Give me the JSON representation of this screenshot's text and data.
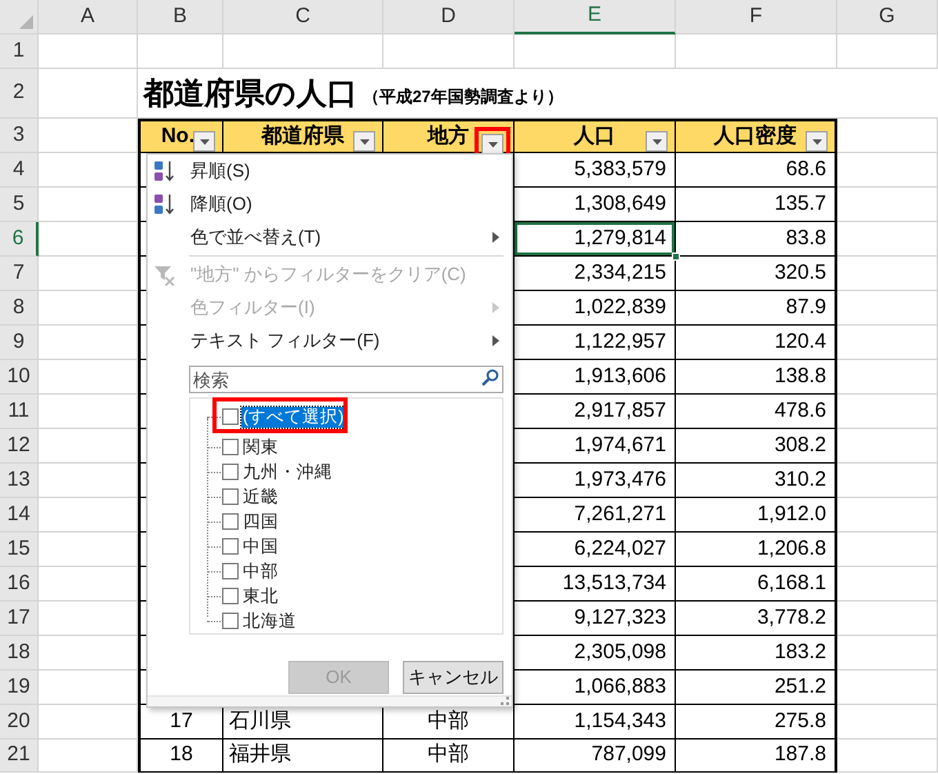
{
  "sheet": {
    "column_headers": [
      "A",
      "B",
      "C",
      "D",
      "E",
      "F",
      "G"
    ],
    "row_headers": [
      "1",
      "2",
      "3",
      "4",
      "5",
      "6",
      "7",
      "8",
      "9",
      "10",
      "11",
      "12",
      "13",
      "14",
      "15",
      "16",
      "17",
      "18",
      "19",
      "20",
      "21"
    ]
  },
  "title": "都道府県の人口",
  "subtitle": "（平成27年国勢調査より）",
  "table": {
    "columns": [
      {
        "label": "No.",
        "highlighted": false
      },
      {
        "label": "都道府県",
        "highlighted": false
      },
      {
        "label": "地方",
        "highlighted": true
      },
      {
        "label": "人口",
        "highlighted": false
      },
      {
        "label": "人口密度",
        "highlighted": false
      }
    ],
    "rows": [
      {
        "population": "5,383,579",
        "density": "68.6",
        "selected": false
      },
      {
        "population": "1,308,649",
        "density": "135.7",
        "selected": false
      },
      {
        "population": "1,279,814",
        "density": "83.8",
        "selected": true
      },
      {
        "population": "2,334,215",
        "density": "320.5",
        "selected": false
      },
      {
        "population": "1,022,839",
        "density": "87.9",
        "selected": false
      },
      {
        "population": "1,122,957",
        "density": "120.4",
        "selected": false
      },
      {
        "population": "1,913,606",
        "density": "138.8",
        "selected": false
      },
      {
        "population": "2,917,857",
        "density": "478.6",
        "selected": false
      },
      {
        "population": "1,974,671",
        "density": "308.2",
        "selected": false
      },
      {
        "population": "1,973,476",
        "density": "310.2",
        "selected": false
      },
      {
        "population": "7,261,271",
        "density": "1,912.0",
        "selected": false
      },
      {
        "population": "6,224,027",
        "density": "1,206.8",
        "selected": false
      },
      {
        "population": "13,513,734",
        "density": "6,168.1",
        "selected": false
      },
      {
        "population": "9,127,323",
        "density": "3,778.2",
        "selected": false
      },
      {
        "population": "2,305,098",
        "density": "183.2",
        "selected": false
      },
      {
        "population": "1,066,883",
        "density": "251.2",
        "selected": false
      },
      {
        "no": "17",
        "prefecture": "石川県",
        "region": "中部",
        "population": "1,154,343",
        "density": "275.8",
        "selected": false
      },
      {
        "no": "18",
        "prefecture": "福井県",
        "region": "中部",
        "population": "787,099",
        "density": "187.8",
        "selected": false
      }
    ]
  },
  "filter_menu": {
    "items": [
      {
        "kind": "sort_asc",
        "label": "昇順(S)",
        "disabled": false,
        "submenu": false
      },
      {
        "kind": "sort_desc",
        "label": "降順(O)",
        "disabled": false,
        "submenu": false
      },
      {
        "kind": "plain",
        "label": "色で並べ替え(T)",
        "disabled": false,
        "submenu": true
      },
      {
        "kind": "separator"
      },
      {
        "kind": "clear_filter",
        "label": "\"地方\" からフィルターをクリア(C)",
        "disabled": true,
        "submenu": false
      },
      {
        "kind": "plain",
        "label": "色フィルター(I)",
        "disabled": true,
        "submenu": true
      },
      {
        "kind": "plain",
        "label": "テキスト フィルター(F)",
        "disabled": false,
        "submenu": true
      }
    ],
    "search": {
      "placeholder": "検索"
    },
    "values": [
      {
        "label": "(すべて選択)",
        "checked": false,
        "selected": true
      },
      {
        "label": "関東",
        "checked": false,
        "selected": false
      },
      {
        "label": "九州・沖縄",
        "checked": false,
        "selected": false
      },
      {
        "label": "近畿",
        "checked": false,
        "selected": false
      },
      {
        "label": "四国",
        "checked": false,
        "selected": false
      },
      {
        "label": "中国",
        "checked": false,
        "selected": false
      },
      {
        "label": "中部",
        "checked": false,
        "selected": false
      },
      {
        "label": "東北",
        "checked": false,
        "selected": false
      },
      {
        "label": "北海道",
        "checked": false,
        "selected": false
      }
    ],
    "buttons": [
      {
        "label": "OK",
        "disabled": true
      },
      {
        "label": "キャンセル",
        "disabled": false
      }
    ]
  }
}
